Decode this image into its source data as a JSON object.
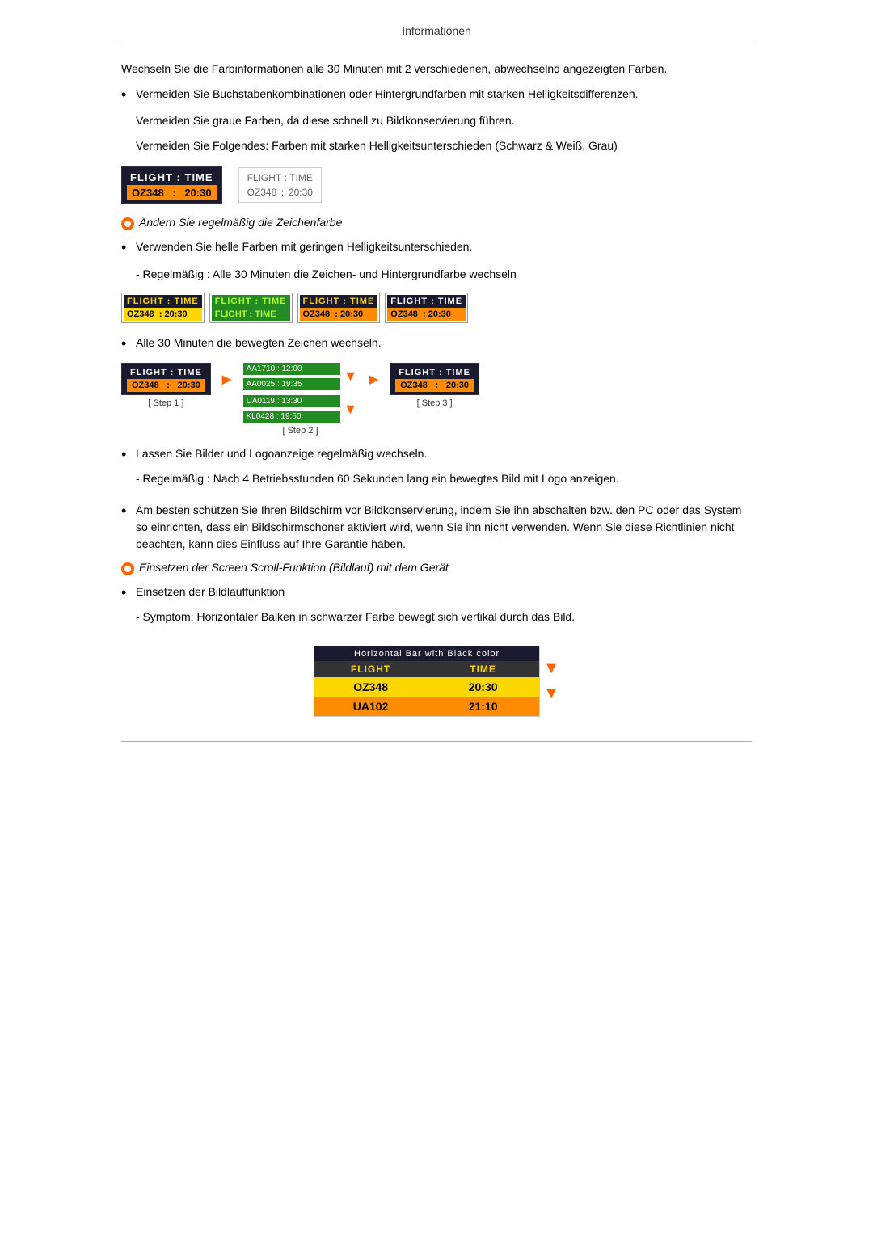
{
  "page": {
    "title": "Informationen"
  },
  "content": {
    "para1": "Wechseln Sie die Farbinformationen alle 30 Minuten mit 2 verschiedenen, abwechselnd angezeigten Farben.",
    "bullet1": "Vermeiden Sie Buchstabenkombinationen oder Hintergrundfarben mit starken Helligkeitsdifferenzen.",
    "sub1": "Vermeiden Sie graue Farben, da diese schnell zu Bildkonservierung führen.",
    "sub2": "Vermeiden Sie Folgendes: Farben mit starken Helligkeitsunterschieden (Schwarz & Weiß, Grau)",
    "orange_heading1": "Ändern Sie regelmäßig die Zeichenfarbe",
    "bullet2": "Verwenden Sie helle Farben mit geringen Helligkeitsunterschieden.",
    "sub3": "- Regelmäßig : Alle 30 Minuten die Zeichen- und Hintergrundfarbe wechseln",
    "bullet3": "Alle 30 Minuten die bewegten Zeichen wechseln.",
    "step1_label": "[ Step 1 ]",
    "step2_label": "[ Step 2 ]",
    "step3_label": "[ Step 3 ]",
    "step2_row1a": "AA1710 : 12:00",
    "step2_row1b": "AA0025 : 19:35",
    "step2_row2a": "UA0119 : 13:30",
    "step2_row2b": "KL0428 : 19:50",
    "bullet4": "Lassen Sie Bilder und Logoanzeige regelmäßig wechseln.",
    "sub4": "- Regelmäßig : Nach 4 Betriebsstunden 60 Sekunden lang ein bewegtes Bild mit Logo anzeigen.",
    "bullet5": "Am besten schützen Sie Ihren Bildschirm vor Bildkonservierung, indem Sie ihn abschalten bzw. den PC oder das System so einrichten, dass ein Bildschirmschoner aktiviert wird, wenn Sie ihn nicht verwenden. Wenn Sie diese Richtlinien nicht beachten, kann dies Einfluss auf Ihre Garantie haben.",
    "orange_heading2": "Einsetzen der Screen Scroll-Funktion (Bildlauf) mit dem Gerät",
    "bullet6": "Einsetzen der Bildlauffunktion",
    "sub5": "- Symptom: Horizontaler Balken in schwarzer Farbe bewegt sich vertikal durch das Bild.",
    "scroll_title": "Horizontal Bar with Black color",
    "scroll_col1_header": "FLIGHT",
    "scroll_col2_header": "TIME",
    "scroll_row1_col1": "OZ348",
    "scroll_row1_col2": "20:30",
    "scroll_row2_col1": "UA102",
    "scroll_row2_col2": "21:10",
    "flight_header_col1": "FLIGHT",
    "flight_colon": ":",
    "flight_header_col2": "TIME",
    "flight_data_col1": "OZ348",
    "flight_data_col2": "20:30",
    "flight_time_label": "FLIGHT  :  TIME",
    "flight_data_label": "OZ348   :  20:30"
  }
}
